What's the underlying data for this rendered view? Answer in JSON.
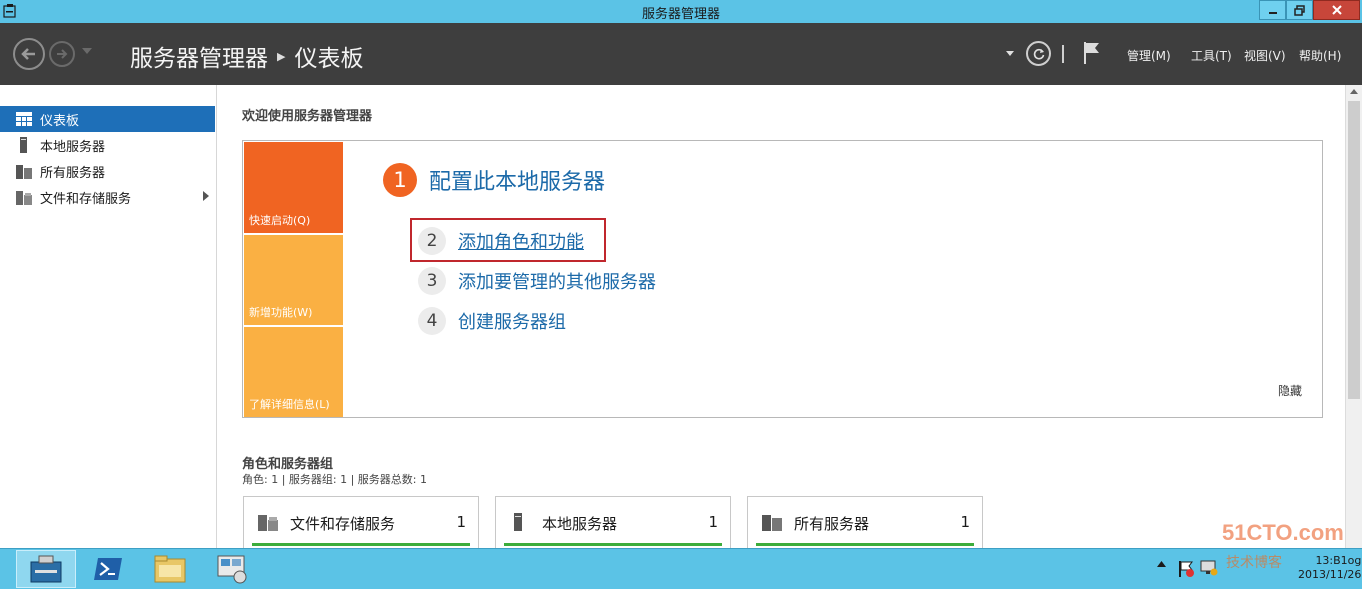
{
  "window": {
    "title": "服务器管理器"
  },
  "header": {
    "breadcrumb": [
      "服务器管理器",
      "仪表板"
    ],
    "menus": [
      "管理(M)",
      "工具(T)",
      "视图(V)",
      "帮助(H)"
    ]
  },
  "sidebar": {
    "items": [
      {
        "label": "仪表板",
        "icon": "dashboard-icon",
        "active": true
      },
      {
        "label": "本地服务器",
        "icon": "server-icon"
      },
      {
        "label": "所有服务器",
        "icon": "servers-icon"
      },
      {
        "label": "文件和存储服务",
        "icon": "file-storage-icon",
        "has_submenu": true
      }
    ]
  },
  "welcome": {
    "title": "欢迎使用服务器管理器",
    "tiles": [
      "快速启动(Q)",
      "新增功能(W)",
      "了解详细信息(L)"
    ],
    "steps": [
      {
        "number": "1",
        "label": "配置此本地服务器"
      },
      {
        "number": "2",
        "label": "添加角色和功能"
      },
      {
        "number": "3",
        "label": "添加要管理的其他服务器"
      },
      {
        "number": "4",
        "label": "创建服务器组"
      }
    ],
    "hide_label": "隐藏"
  },
  "roles": {
    "title": "角色和服务器组",
    "summary": "角色: 1 | 服务器组: 1 | 服务器总数: 1",
    "cards": [
      {
        "name": "文件和存储服务",
        "count": "1",
        "icon": "file-storage-icon"
      },
      {
        "name": "本地服务器",
        "count": "1",
        "icon": "server-icon"
      },
      {
        "name": "所有服务器",
        "count": "1",
        "icon": "servers-icon"
      }
    ]
  },
  "taskbar": {
    "apps": [
      "server-manager-icon",
      "powershell-icon",
      "file-explorer-icon",
      "network-icon"
    ],
    "watermark": "51CTO.com",
    "watermark_sub": "技术博客",
    "clock_time": "13:B1og",
    "clock_date": "2013/11/26"
  },
  "colors": {
    "titlebar": "#5bc3e6",
    "header": "#3e3e3e",
    "accent_orange": "#f06422",
    "tile_light": "#fab043",
    "link_blue": "#1c6aa9",
    "active_nav": "#1e6fb8",
    "highlight_box": "#c0272d",
    "status_green": "#3cad3c"
  }
}
